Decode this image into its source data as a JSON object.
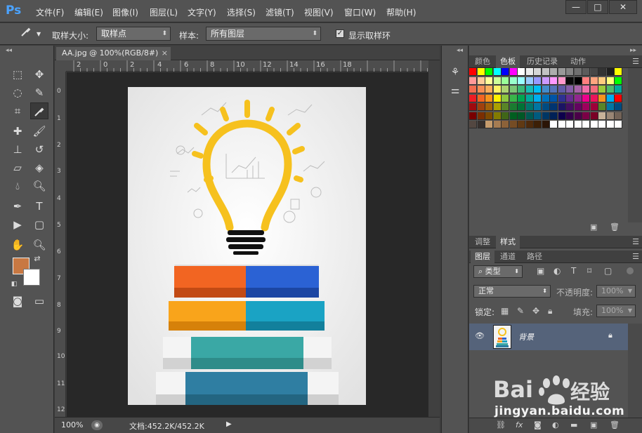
{
  "app": {
    "logo": "Ps"
  },
  "menu": [
    "文件(F)",
    "编辑(E)",
    "图像(I)",
    "图层(L)",
    "文字(Y)",
    "选择(S)",
    "滤镜(T)",
    "视图(V)",
    "窗口(W)",
    "帮助(H)"
  ],
  "window_controls": {
    "minimize": "—",
    "maximize": "□",
    "close": "✕"
  },
  "options": {
    "sample_size_label": "取样大小:",
    "sample_size_value": "取样点",
    "sample_label": "样本:",
    "sample_value": "所有图层",
    "show_ring_label": "显示取样环",
    "show_ring_checked": true
  },
  "document": {
    "tab_title": "AA.jpg @ 100%(RGB/8#)",
    "tab_close": "×",
    "zoom": "100%",
    "doc_size": "文档:452.2K/452.2K",
    "ruler_top": [
      "2",
      "0",
      "2",
      "4",
      "6",
      "8",
      "10",
      "12",
      "14",
      "16",
      "18"
    ],
    "ruler_left": [
      "0",
      "1",
      "2",
      "3",
      "4",
      "5",
      "6",
      "7",
      "8",
      "9",
      "10",
      "11",
      "12"
    ]
  },
  "colors": {
    "foreground": "#c87842",
    "background": "#ffffff",
    "accent_layer_row": "#55637a"
  },
  "swatches_panel": {
    "tabs": [
      "颜色",
      "色板",
      "历史记录",
      "动作"
    ],
    "active_tab": "色板",
    "rows": [
      [
        "#ff0000",
        "#ffff00",
        "#00ff00",
        "#00ffff",
        "#0000ff",
        "#ff00ff",
        "#ffffff",
        "#ebebeb",
        "#d6d6d6",
        "#c2c2c2",
        "#adadad",
        "#999999",
        "#858585",
        "#707070",
        "#5c5c5c",
        "#474747",
        "#333333",
        "#1f1f1f",
        "#ffff00"
      ],
      [
        "#ff9999",
        "#ffcc99",
        "#ffff99",
        "#ccff99",
        "#99ff99",
        "#99ffcc",
        "#99ffff",
        "#99ccff",
        "#9999ff",
        "#cc99ff",
        "#ff99ff",
        "#ff99cc",
        "#0a0a0a",
        "#000000",
        "#ff7f7f",
        "#ffa57f",
        "#ffcc7f",
        "#ffff7f",
        "#00ff00"
      ],
      [
        "#f26c4f",
        "#f68e55",
        "#fbaf5d",
        "#fff467",
        "#acd372",
        "#7cc576",
        "#3bb878",
        "#1abbb4",
        "#00bff3",
        "#438ccb",
        "#5574b9",
        "#605ca8",
        "#855fa8",
        "#a763a8",
        "#f06ea9",
        "#f26d7d",
        "#9ccb3b",
        "#4dbb6b",
        "#00a99d"
      ],
      [
        "#ed1c24",
        "#f26522",
        "#f7941d",
        "#fff200",
        "#8dc73f",
        "#39b54a",
        "#00a651",
        "#00a99d",
        "#00aeef",
        "#0072bc",
        "#0054a6",
        "#2e3192",
        "#662d91",
        "#92278f",
        "#ec008c",
        "#ed145b",
        "#f7941d",
        "#00aeef",
        "#ff0000"
      ],
      [
        "#9e0b0f",
        "#a0410d",
        "#a36209",
        "#aba000",
        "#598527",
        "#1a7b30",
        "#007236",
        "#00746b",
        "#0076a3",
        "#004b80",
        "#003471",
        "#1b1464",
        "#440e62",
        "#630460",
        "#9e005d",
        "#9e0039",
        "#598527",
        "#0076a3",
        "#004b80"
      ],
      [
        "#790000",
        "#7b2e00",
        "#7d4900",
        "#827b00",
        "#406618",
        "#005e20",
        "#005826",
        "#005952",
        "#005b7f",
        "#003663",
        "#002157",
        "#0d004c",
        "#32004b",
        "#4b0049",
        "#7b0046",
        "#7a0026",
        "#c7b299",
        "#998675",
        "#736357"
      ],
      [
        "#534741",
        "#37302d",
        "#c69c6d",
        "#a67c52",
        "#8c6239",
        "#754c24",
        "#603913",
        "#4d2a0c",
        "#3c1f06",
        "#2b1506",
        "#ffffff",
        "#ffffff",
        "#ffffff",
        "#ffffff",
        "#ffffff",
        "#ffffff",
        "#ffffff",
        "#ffffff",
        "#ffffff"
      ]
    ]
  },
  "adjust_panel": {
    "tabs": [
      "调整",
      "样式"
    ],
    "active_tab": "样式"
  },
  "layers_panel": {
    "tabs": [
      "图层",
      "通道",
      "路径"
    ],
    "active_tab": "图层",
    "filter_value": "类型",
    "blend_mode": "正常",
    "opacity_label": "不透明度:",
    "opacity_value": "100%",
    "lock_label": "锁定:",
    "fill_label": "填充:",
    "fill_value": "100%",
    "layer_name": "背景"
  },
  "watermark": {
    "brand": "Bai 经验",
    "url": "jingyan.baidu.com"
  }
}
